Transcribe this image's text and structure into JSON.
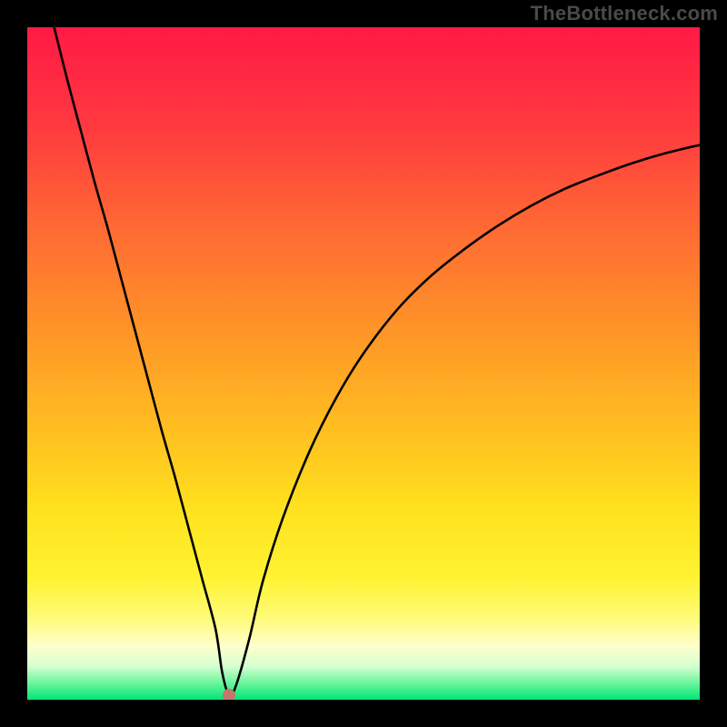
{
  "watermark": "TheBottleneck.com",
  "chart_data": {
    "type": "line",
    "title": "",
    "xlabel": "",
    "ylabel": "",
    "xlim": [
      0,
      100
    ],
    "ylim": [
      0,
      100
    ],
    "x": [
      4,
      6,
      8,
      10,
      12,
      14,
      16,
      18,
      20,
      22,
      24,
      26,
      28,
      29,
      30,
      31,
      33,
      35,
      38,
      42,
      46,
      50,
      55,
      60,
      65,
      70,
      75,
      80,
      85,
      90,
      95,
      100
    ],
    "values": [
      100,
      92,
      84.5,
      77,
      70,
      62.5,
      55,
      47.5,
      40,
      33,
      25.5,
      18,
      10.5,
      4,
      0.7,
      2,
      9,
      17.5,
      27,
      37,
      45,
      51.5,
      58,
      63,
      67,
      70.5,
      73.5,
      76,
      78,
      79.8,
      81.3,
      82.5
    ],
    "min_marker": {
      "x": 30,
      "y": 0.7,
      "color": "#c4766a"
    },
    "band_top_y": 14,
    "green_band_top_y": 4,
    "green_band_bottom_y": 0,
    "gradient_stops": [
      {
        "y": 100,
        "color": "#ff1a45"
      },
      {
        "y": 85,
        "color": "#ff3a3f"
      },
      {
        "y": 70,
        "color": "#ff6a33"
      },
      {
        "y": 55,
        "color": "#ff9428"
      },
      {
        "y": 40,
        "color": "#ffbf20"
      },
      {
        "y": 28,
        "color": "#ffe21e"
      },
      {
        "y": 18,
        "color": "#fff333"
      },
      {
        "y": 12,
        "color": "#fffb7a"
      },
      {
        "y": 8,
        "color": "#ffffcc"
      },
      {
        "y": 5,
        "color": "#d6ffd0"
      },
      {
        "y": 2.5,
        "color": "#6cf59c"
      },
      {
        "y": 0,
        "color": "#00e676"
      }
    ]
  }
}
